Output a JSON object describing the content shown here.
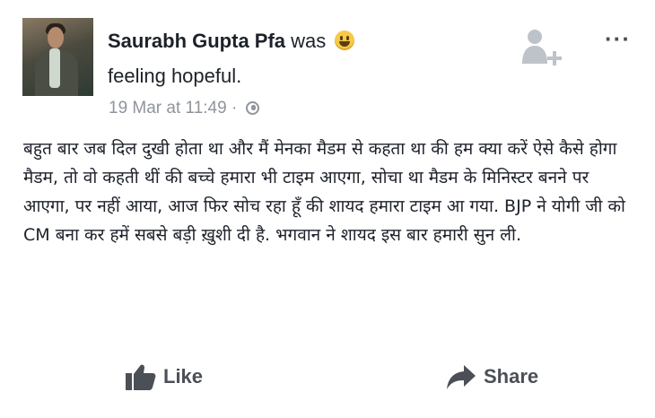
{
  "post": {
    "author": "Saurabh Gupta Pfa",
    "was": "was",
    "feeling": "feeling hopeful.",
    "timestamp": "19 Mar at 11:49",
    "separator": "·",
    "body": "बहुत बार जब दिल दुखी होता था और मैं मेनका मैडम से कहता था की हम क्या करें ऐसे कैसे होगा मैडम, तो वो कहती थीं की बच्चे हमारा भी टाइम आएगा, सोचा था मैडम के मिनिस्टर बनने पर आएगा, पर नहीं आया, आज फिर सोच रहा हूँ की शायद हमारा टाइम आ गया. BJP ने योगी जी को CM बना कर हमें सबसे बड़ी ख़ुशी दी है. भगवान ने शायद इस बार हमारी सुन ली."
  },
  "header": {
    "more_label": "···",
    "feeling_icon": "smiley-icon",
    "privacy_icon": "globe-icon",
    "add_friend_icon": "add-friend-icon"
  },
  "actions": {
    "like_label": "Like",
    "share_label": "Share"
  },
  "colors": {
    "text": "#1d2129",
    "meta": "#90949c",
    "action": "#4b4f56"
  }
}
